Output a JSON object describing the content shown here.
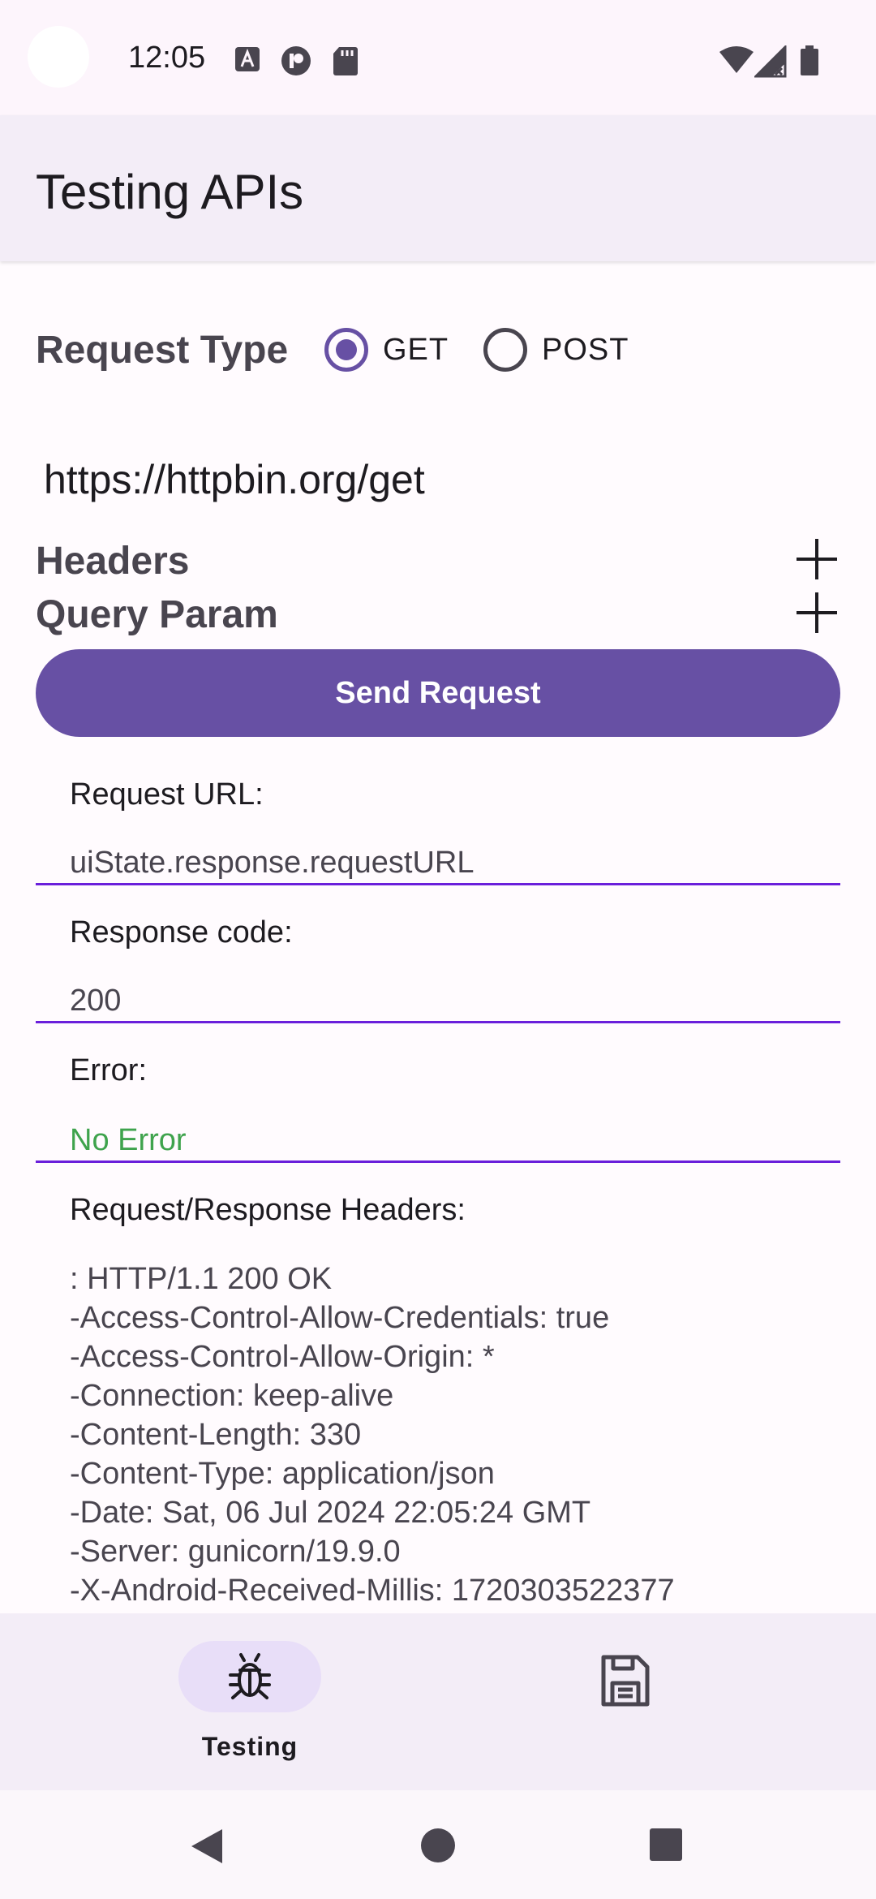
{
  "status_bar": {
    "time": "12:05",
    "icons": [
      "a-notification-icon",
      "p-notification-icon",
      "sd-card-icon",
      "wifi-icon",
      "cellular-signal-icon",
      "battery-icon"
    ]
  },
  "app_bar": {
    "title": "Testing APIs"
  },
  "request_type": {
    "label": "Request Type",
    "options": [
      {
        "label": "GET",
        "selected": true
      },
      {
        "label": "POST",
        "selected": false
      }
    ]
  },
  "url": {
    "value": "https://httpbin.org/get"
  },
  "headers_section": {
    "label": "Headers"
  },
  "query_section": {
    "label": "Query Param"
  },
  "send_button": {
    "label": "Send Request"
  },
  "response": {
    "request_url_label": "Request URL:",
    "request_url_value": "uiState.response.requestURL",
    "response_code_label": "Response code:",
    "response_code_value": "200",
    "error_label": "Error:",
    "error_value": "No Error",
    "headers_label": "Request/Response Headers:",
    "headers_lines": [
      ": HTTP/1.1 200 OK",
      "-Access-Control-Allow-Credentials: true",
      "-Access-Control-Allow-Origin: *",
      "-Connection: keep-alive",
      "-Content-Length: 330",
      "-Content-Type: application/json",
      "-Date: Sat, 06 Jul 2024 22:05:24 GMT",
      "-Server: gunicorn/19.9.0",
      "-X-Android-Received-Millis: 1720303522377"
    ]
  },
  "bottom_nav": {
    "items": [
      {
        "label": "Testing",
        "icon": "bug-icon",
        "selected": true
      },
      {
        "label": "",
        "icon": "save-icon",
        "selected": false
      }
    ]
  },
  "colors": {
    "accent": "#6750a4",
    "underline": "#6a1fdb",
    "success": "#3fa34d"
  }
}
